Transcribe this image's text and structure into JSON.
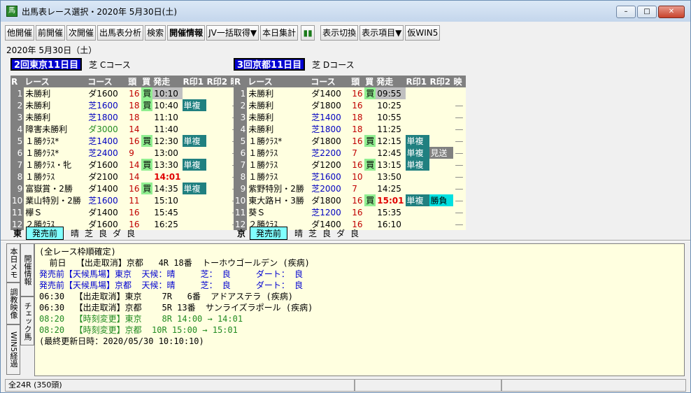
{
  "window": {
    "title": "出馬表レース選択・2020年 5月30日(土)",
    "icon": "horse-icon",
    "controls": [
      "–",
      "□",
      "✕"
    ]
  },
  "toolbar": [
    "他開催",
    "前開催",
    "次開催",
    "出馬表分析",
    "検索",
    "開催情報",
    "JV一括取得▼",
    "本日集計",
    "",
    "表示切換",
    "表示項目▼",
    "仮WIN5"
  ],
  "date": "2020年  5月30日（土）",
  "venues": [
    {
      "name": "2回東京11日目",
      "course": "芝 Cコース",
      "status_label": "東",
      "status": "発売前",
      "weather": "晴",
      "surf1": "芝",
      "cond1": "良",
      "surf2": "ダ",
      "cond2": "良",
      "races": [
        {
          "no": "1",
          "name": "未勝利",
          "course": "ダ1600",
          "type": "da",
          "head": "16",
          "buy": "買",
          "time": "10:10",
          "tstyle": "gray",
          "r1": "",
          "r2": "",
          "vid": ""
        },
        {
          "no": "2",
          "name": "未勝利",
          "course": "芝1600",
          "type": "shiba",
          "head": "18",
          "buy": "買",
          "time": "10:40",
          "tstyle": "",
          "r1": "単複",
          "r2": "",
          "vid": "—"
        },
        {
          "no": "3",
          "name": "未勝利",
          "course": "芝1800",
          "type": "shiba",
          "head": "18",
          "buy": "",
          "time": "11:10",
          "tstyle": "",
          "r1": "",
          "r2": "",
          "vid": "—"
        },
        {
          "no": "4",
          "name": "障害未勝利",
          "course": "ダ3000",
          "type": "dahl",
          "head": "14",
          "buy": "",
          "time": "11:40",
          "tstyle": "",
          "r1": "",
          "r2": "",
          "vid": "—"
        },
        {
          "no": "5",
          "name": "１勝ｸﾗｽ*",
          "course": "芝1400",
          "type": "shiba",
          "head": "16",
          "buy": "買",
          "time": "12:30",
          "tstyle": "",
          "r1": "単複",
          "r2": "",
          "vid": "—"
        },
        {
          "no": "6",
          "name": "１勝ｸﾗｽ*",
          "course": "芝2400",
          "type": "shiba",
          "head": "9",
          "buy": "",
          "time": "13:00",
          "tstyle": "",
          "r1": "",
          "r2": "",
          "vid": "—"
        },
        {
          "no": "7",
          "name": "１勝ｸﾗｽ・牝",
          "course": "ダ1600",
          "type": "da",
          "head": "14",
          "buy": "買",
          "time": "13:30",
          "tstyle": "",
          "r1": "単複",
          "r2": "",
          "vid": "—"
        },
        {
          "no": "8",
          "name": "１勝ｸﾗｽ",
          "course": "ダ2100",
          "type": "da",
          "head": "14",
          "buy": "",
          "time": "14:01",
          "tstyle": "hi",
          "r1": "",
          "r2": "",
          "vid": "—"
        },
        {
          "no": "9",
          "name": "富嶽賞・2勝",
          "course": "ダ1400",
          "type": "da",
          "head": "16",
          "buy": "買",
          "time": "14:35",
          "tstyle": "",
          "r1": "単複",
          "r2": "",
          "vid": "—"
        },
        {
          "no": "10",
          "name": "業山特別・2勝",
          "course": "芝1600",
          "type": "shiba",
          "head": "11",
          "buy": "",
          "time": "15:10",
          "tstyle": "",
          "r1": "",
          "r2": "",
          "vid": "—"
        },
        {
          "no": "11",
          "name": "欅Ｓ",
          "course": "ダ1400",
          "type": "da",
          "head": "16",
          "buy": "",
          "time": "15:45",
          "tstyle": "",
          "r1": "",
          "r2": "",
          "vid": "—"
        },
        {
          "no": "12",
          "name": "２勝ｸﾗｽ",
          "course": "ダ1600",
          "type": "da",
          "head": "16",
          "buy": "",
          "time": "16:25",
          "tstyle": "",
          "r1": "",
          "r2": "",
          "vid": "—"
        }
      ]
    },
    {
      "name": "3回京都11日目",
      "course": "芝 Dコース",
      "status_label": "京",
      "status": "発売前",
      "weather": "晴",
      "surf1": "芝",
      "cond1": "良",
      "surf2": "ダ",
      "cond2": "良",
      "races": [
        {
          "no": "1",
          "name": "未勝利",
          "course": "ダ1400",
          "type": "da",
          "head": "16",
          "buy": "買",
          "time": "09:55",
          "tstyle": "gray",
          "r1": "",
          "r2": "",
          "vid": ""
        },
        {
          "no": "2",
          "name": "未勝利",
          "course": "ダ1800",
          "type": "da",
          "head": "16",
          "buy": "",
          "time": "10:25",
          "tstyle": "",
          "r1": "",
          "r2": "",
          "vid": "—"
        },
        {
          "no": "3",
          "name": "未勝利",
          "course": "芝1400",
          "type": "shiba",
          "head": "18",
          "buy": "",
          "time": "10:55",
          "tstyle": "",
          "r1": "",
          "r2": "",
          "vid": "—"
        },
        {
          "no": "4",
          "name": "未勝利",
          "course": "芝1800",
          "type": "shiba",
          "head": "18",
          "buy": "",
          "time": "11:25",
          "tstyle": "",
          "r1": "",
          "r2": "",
          "vid": "—"
        },
        {
          "no": "5",
          "name": "１勝ｸﾗｽ*",
          "course": "ダ1800",
          "type": "da",
          "head": "16",
          "buy": "買",
          "time": "12:15",
          "tstyle": "",
          "r1": "単複",
          "r2": "",
          "vid": "—"
        },
        {
          "no": "6",
          "name": "１勝ｸﾗｽ",
          "course": "芝2200",
          "type": "shiba",
          "head": "7",
          "buy": "",
          "time": "12:45",
          "tstyle": "",
          "r1": "単複",
          "r2": "見送",
          "vid": "—"
        },
        {
          "no": "7",
          "name": "１勝ｸﾗｽ",
          "course": "ダ1200",
          "type": "da",
          "head": "16",
          "buy": "買",
          "time": "13:15",
          "tstyle": "",
          "r1": "単複",
          "r2": "",
          "vid": "—"
        },
        {
          "no": "8",
          "name": "１勝ｸﾗｽ",
          "course": "芝1600",
          "type": "shiba",
          "head": "10",
          "buy": "",
          "time": "13:50",
          "tstyle": "",
          "r1": "",
          "r2": "",
          "vid": "—"
        },
        {
          "no": "9",
          "name": "紫野特別・2勝",
          "course": "芝2000",
          "type": "shiba",
          "head": "7",
          "buy": "",
          "time": "14:25",
          "tstyle": "",
          "r1": "",
          "r2": "",
          "vid": "—"
        },
        {
          "no": "10",
          "name": "東大路Ｈ・3勝",
          "course": "ダ1800",
          "type": "da",
          "head": "16",
          "buy": "買",
          "time": "15:01",
          "tstyle": "hi",
          "r1": "単複",
          "r2": "勝負",
          "vid": "—",
          "selected": true
        },
        {
          "no": "11",
          "name": "葵Ｓ",
          "course": "芝1200",
          "type": "shiba",
          "head": "16",
          "buy": "",
          "time": "15:35",
          "tstyle": "",
          "r1": "",
          "r2": "",
          "vid": "—"
        },
        {
          "no": "12",
          "name": "２勝ｸﾗｽ",
          "course": "ダ1400",
          "type": "da",
          "head": "16",
          "buy": "",
          "time": "16:10",
          "tstyle": "",
          "r1": "",
          "r2": "",
          "vid": "—"
        }
      ]
    }
  ],
  "headers": [
    "R",
    "レース",
    "コース",
    "頭",
    "買",
    "発走",
    "R印1",
    "R印2",
    "映"
  ],
  "vtabs": [
    "本日メモ",
    "開催情報",
    "調教映像",
    "チェック馬",
    "WIN5経過"
  ],
  "memo": [
    {
      "text": "(全レース枠順確定)",
      "c": ""
    },
    {
      "text": "  前日  【出走取消】京都   4R 18番  トーホウゴールデン (疾病)",
      "c": ""
    },
    {
      "text": "発売前【天候馬場】東京  天候：晴     芝： 良     ダート： 良",
      "c": "blue"
    },
    {
      "text": "発売前【天候馬場】京都  天候：晴     芝： 良     ダート： 良",
      "c": "blue"
    },
    {
      "text": "06:30  【出走取消】東京    7R   6番  アドアステラ (疾病)",
      "c": ""
    },
    {
      "text": "06:30  【出走取消】京都    5R 13番  サンライズラポール (疾病)",
      "c": ""
    },
    {
      "text": "08:20  【時刻変更】東京    8R 14:00 → 14:01",
      "c": "green"
    },
    {
      "text": "08:20  【時刻変更】京都  10R 15:00 → 15:01",
      "c": "green"
    },
    {
      "text": "(最終更新日時：2020/05/30 10:10:10)",
      "c": ""
    }
  ],
  "statusbar": [
    "全24R (350頭)",
    "",
    ""
  ]
}
